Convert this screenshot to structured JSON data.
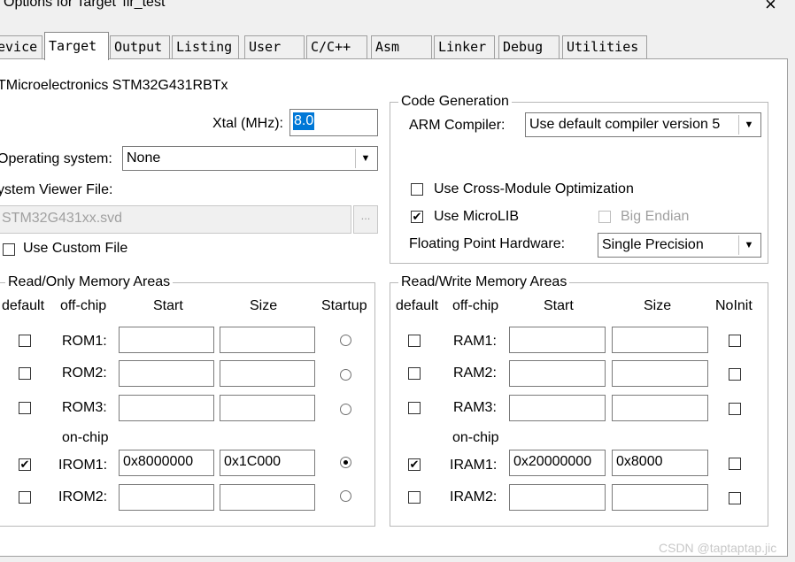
{
  "window": {
    "title": "Options for Target 'fir_test'",
    "close": "×"
  },
  "tabs": [
    "evice",
    "Target",
    "Output",
    "Listing",
    "User",
    "C/C++",
    "Asm",
    "Linker",
    "Debug",
    "Utilities"
  ],
  "device_name": "TMicroelectronics STM32G431RBTx",
  "xtal": {
    "label": "Xtal (MHz):",
    "value": "8.0"
  },
  "os": {
    "label": "Operating system:",
    "value": "None"
  },
  "svd": {
    "label": "ystem Viewer File:",
    "value": "STM32G431xx.svd",
    "browse": "...",
    "custom_label": "Use Custom File",
    "custom_checked": false
  },
  "code_gen": {
    "legend": "Code Generation",
    "compiler_label": "ARM Compiler:",
    "compiler_value": "Use default compiler version 5",
    "cross_module": {
      "label": "Use Cross-Module Optimization",
      "checked": false
    },
    "microlib": {
      "label": "Use MicroLIB",
      "checked": true
    },
    "big_endian": {
      "label": "Big Endian",
      "checked": false
    },
    "fp_label": "Floating Point Hardware:",
    "fp_value": "Single Precision"
  },
  "ro_memory": {
    "legend": "Read/Only Memory Areas",
    "headers": {
      "default": "default",
      "offchip": "off-chip",
      "start": "Start",
      "size": "Size",
      "startup": "Startup"
    },
    "onchip_label": "on-chip",
    "rows": [
      {
        "name": "ROM1:",
        "default": false,
        "start": "",
        "size": "",
        "startup": false
      },
      {
        "name": "ROM2:",
        "default": false,
        "start": "",
        "size": "",
        "startup": false
      },
      {
        "name": "ROM3:",
        "default": false,
        "start": "",
        "size": "",
        "startup": false
      },
      {
        "name": "IROM1:",
        "default": true,
        "start": "0x8000000",
        "size": "0x1C000",
        "startup": true
      },
      {
        "name": "IROM2:",
        "default": false,
        "start": "",
        "size": "",
        "startup": false
      }
    ]
  },
  "rw_memory": {
    "legend": "Read/Write Memory Areas",
    "headers": {
      "default": "default",
      "offchip": "off-chip",
      "start": "Start",
      "size": "Size",
      "noinit": "NoInit"
    },
    "onchip_label": "on-chip",
    "rows": [
      {
        "name": "RAM1:",
        "default": false,
        "start": "",
        "size": "",
        "noinit": false
      },
      {
        "name": "RAM2:",
        "default": false,
        "start": "",
        "size": "",
        "noinit": false
      },
      {
        "name": "RAM3:",
        "default": false,
        "start": "",
        "size": "",
        "noinit": false
      },
      {
        "name": "IRAM1:",
        "default": true,
        "start": "0x20000000",
        "size": "0x8000",
        "noinit": false
      },
      {
        "name": "IRAM2:",
        "default": false,
        "start": "",
        "size": "",
        "noinit": false
      }
    ]
  },
  "watermark": "CSDN @taptaptap.jic",
  "icons": {
    "check": "✔",
    "dropdown": "▼"
  }
}
